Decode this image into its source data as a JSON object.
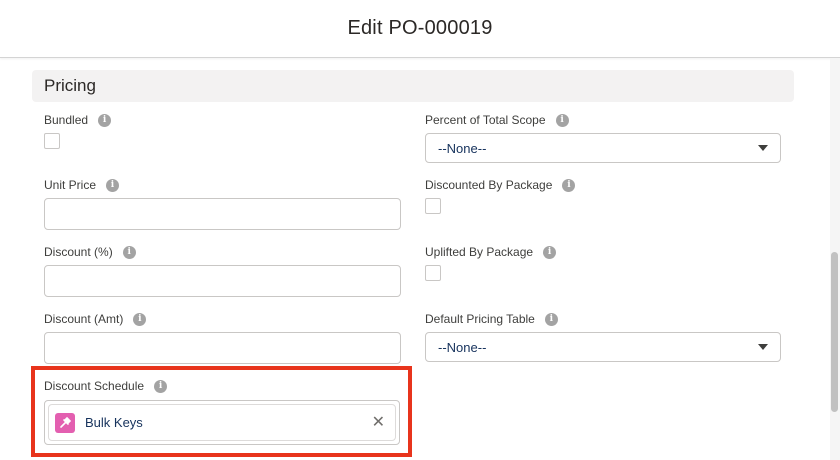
{
  "modal": {
    "title": "Edit PO-000019"
  },
  "section": {
    "title": "Pricing"
  },
  "left_fields": {
    "bundled": {
      "label": "Bundled"
    },
    "unit_price": {
      "label": "Unit Price",
      "value": ""
    },
    "discount_pct": {
      "label": "Discount (%)",
      "value": ""
    },
    "discount_amt": {
      "label": "Discount (Amt)",
      "value": ""
    },
    "discount_schedule": {
      "label": "Discount Schedule",
      "value": "Bulk Keys",
      "remove_glyph": "✕"
    }
  },
  "right_fields": {
    "percent_total_scope": {
      "label": "Percent of Total Scope",
      "value": "--None--"
    },
    "discounted_by_package": {
      "label": "Discounted By Package"
    },
    "uplifted_by_package": {
      "label": "Uplifted By Package"
    },
    "default_pricing_table": {
      "label": "Default Pricing Table",
      "value": "--None--"
    }
  },
  "icons": {
    "info": "i"
  },
  "colors": {
    "highlight": "#e8341c",
    "record_icon": "#e35fb0"
  }
}
